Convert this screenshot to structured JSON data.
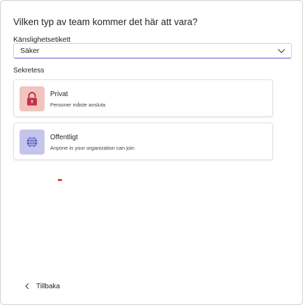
{
  "dialog": {
    "title": "Vilken typ av team kommer det här att vara?"
  },
  "sensitivity": {
    "label": "Känslighetsetikett",
    "value": "Säker",
    "icon": "chevron-down-icon"
  },
  "privacy": {
    "label": "Sekretess",
    "options": [
      {
        "title": "Privat",
        "description": "Personer måste ansluta",
        "icon": "lock-icon",
        "icon_tile_color": "#f1c4bd",
        "icon_color": "#c4314b"
      },
      {
        "title": "Offentligt",
        "description": "Anyone in your organization can join",
        "icon": "globe-icon",
        "icon_tile_color": "#c5c5ec",
        "icon_color": "#5b5fc7"
      }
    ]
  },
  "footer": {
    "back_label": "Tillbaka",
    "back_icon": "chevron-left-icon"
  },
  "colors": {
    "accent": "#5b5fc7",
    "border": "#d1d1d1",
    "text": "#242424"
  }
}
